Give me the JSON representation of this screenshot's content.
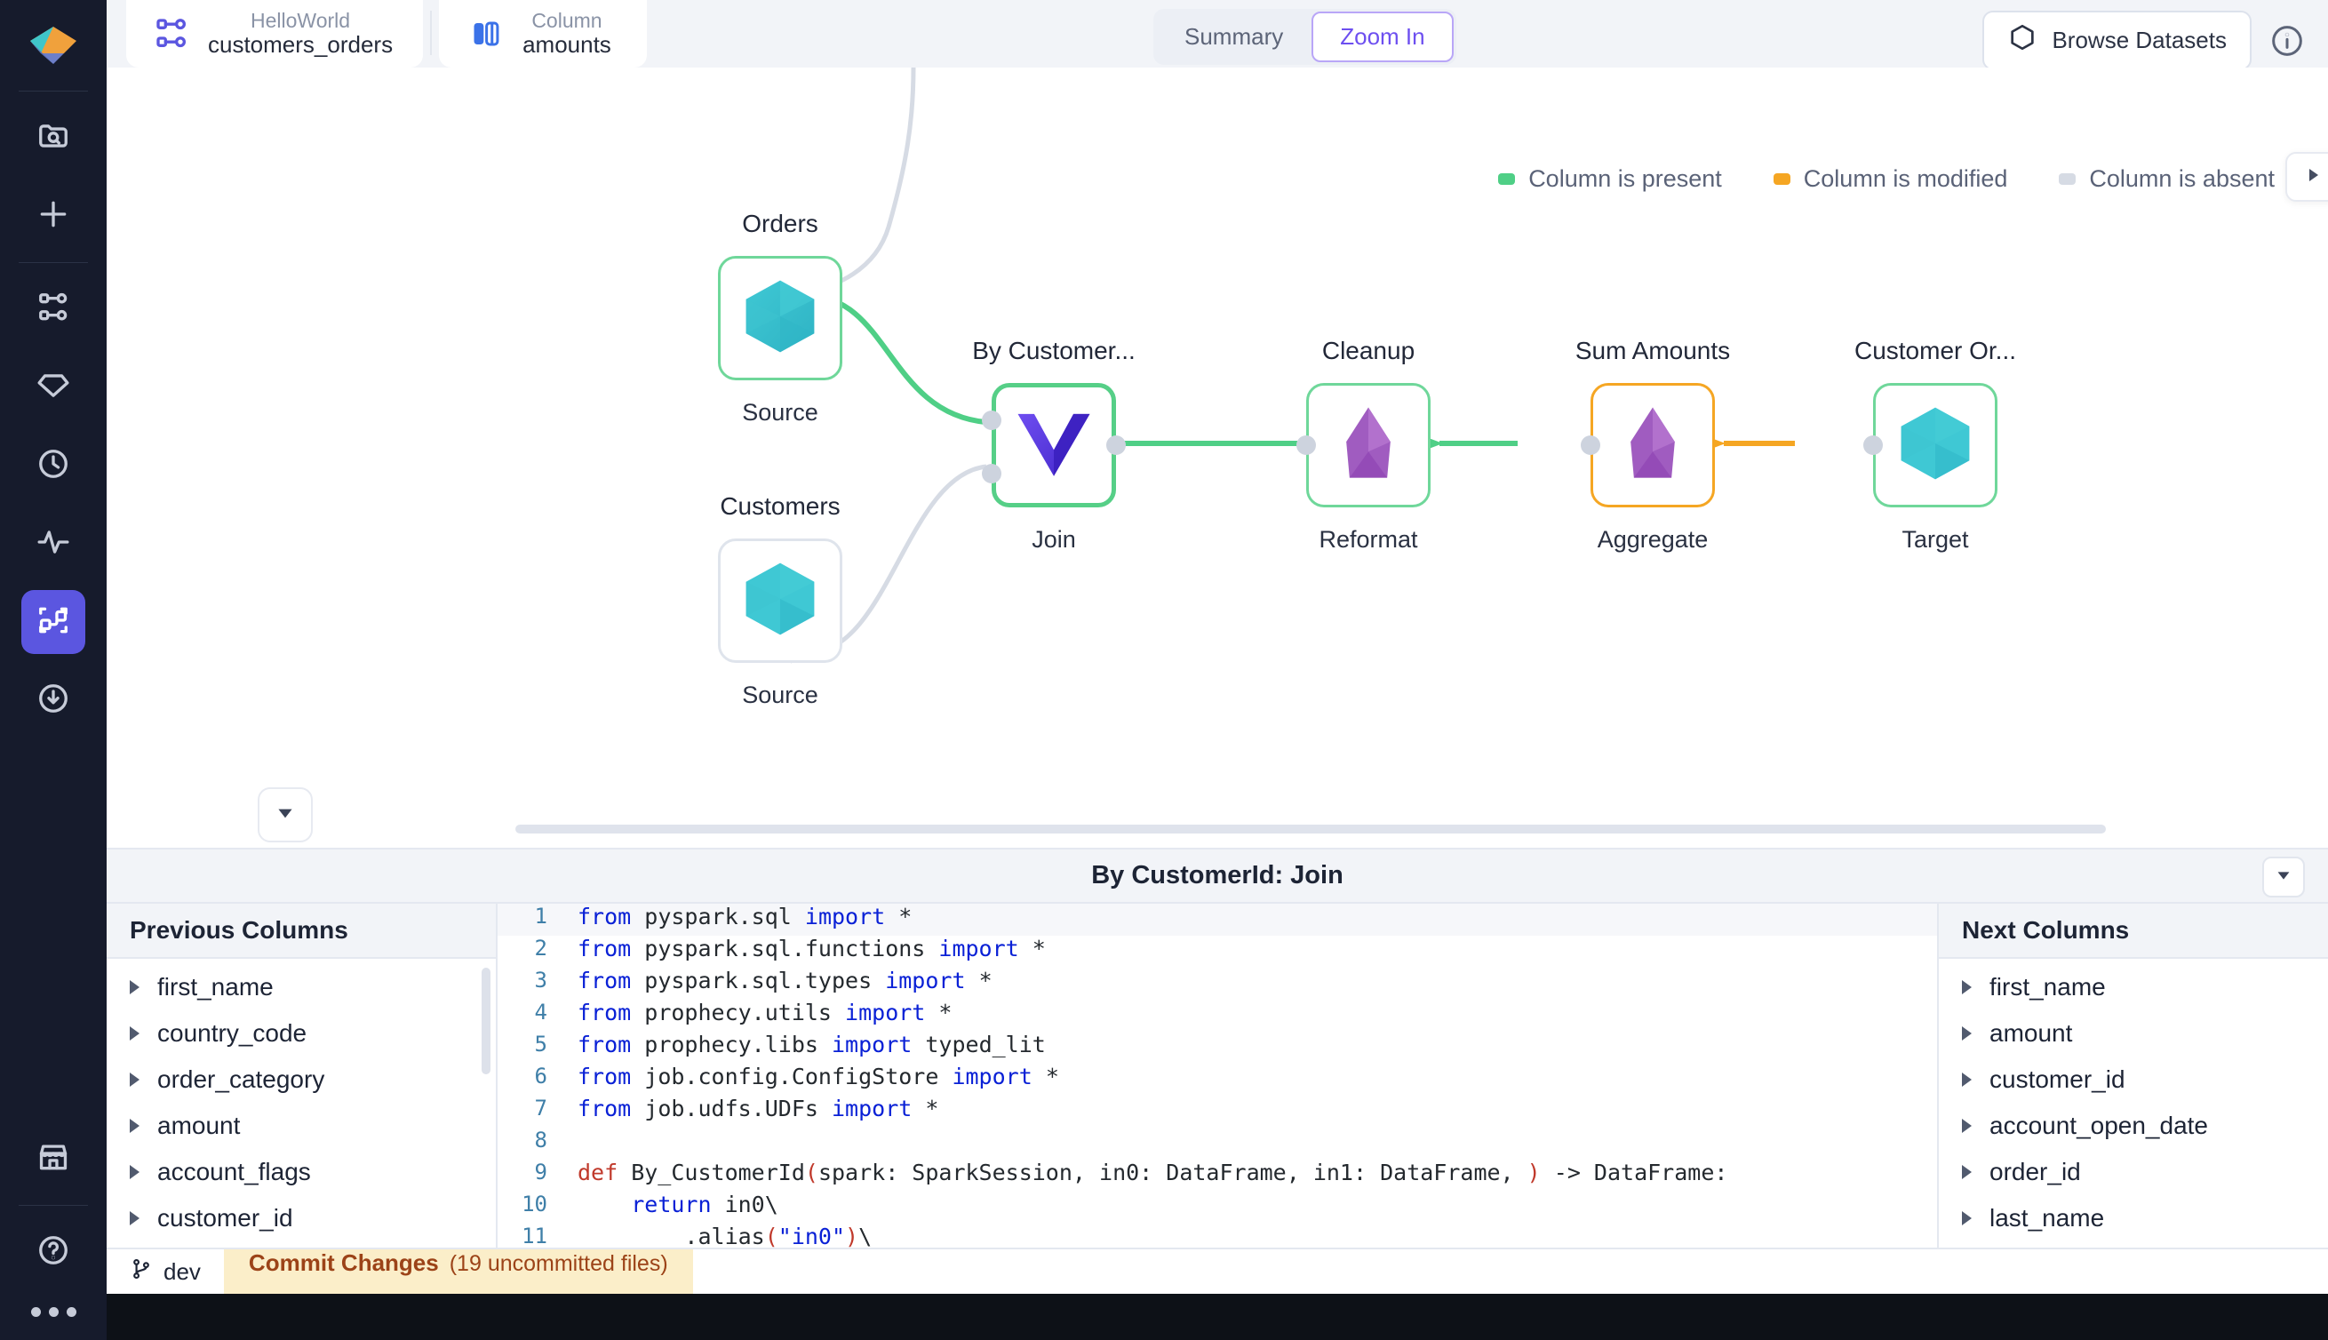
{
  "topbar": {
    "project_tab": {
      "icon": "pipeline-icon",
      "sub": "HelloWorld",
      "main": "customers_orders"
    },
    "column_tab": {
      "icon": "columns-icon",
      "sub": "Column",
      "main": "amounts"
    },
    "segments": [
      {
        "label": "Summary",
        "active": false
      },
      {
        "label": "Zoom In",
        "active": true
      }
    ],
    "browse_datasets": "Browse Datasets",
    "info_icon": "info-icon"
  },
  "legend": [
    {
      "label": "Column is present",
      "color": "#4fcf86"
    },
    {
      "label": "Column is modified",
      "color": "#f5a623"
    },
    {
      "label": "Column is absent",
      "color": "#d6dbe4"
    }
  ],
  "graph": {
    "nodes": [
      {
        "title": "Orders",
        "sub": "Source",
        "shape": "hexagon",
        "border": "green"
      },
      {
        "title": "Customers",
        "sub": "Source",
        "shape": "hexagon",
        "border": "grey"
      },
      {
        "title": "By Customer...",
        "sub": "Join",
        "shape": "chevron",
        "border": "green-thick"
      },
      {
        "title": "Cleanup",
        "sub": "Reformat",
        "shape": "diamond",
        "border": "green"
      },
      {
        "title": "Sum Amounts",
        "sub": "Aggregate",
        "shape": "diamond",
        "border": "orange"
      },
      {
        "title": "Customer Or...",
        "sub": "Target",
        "shape": "hexagon",
        "border": "green"
      }
    ]
  },
  "bottom": {
    "title": "By CustomerId: Join",
    "collapse_icon": "chevron-down-icon",
    "previous_columns": {
      "heading": "Previous Columns",
      "items": [
        "first_name",
        "country_code",
        "order_category",
        "amount",
        "account_flags",
        "customer_id"
      ]
    },
    "next_columns": {
      "heading": "Next Columns",
      "items": [
        "first_name",
        "amount",
        "customer_id",
        "account_open_date",
        "order_id",
        "last_name"
      ]
    },
    "code_lines": [
      {
        "n": "1",
        "text": "from pyspark.sql import *"
      },
      {
        "n": "2",
        "text": "from pyspark.sql.functions import *"
      },
      {
        "n": "3",
        "text": "from pyspark.sql.types import *"
      },
      {
        "n": "4",
        "text": "from prophecy.utils import *"
      },
      {
        "n": "5",
        "text": "from prophecy.libs import typed_lit"
      },
      {
        "n": "6",
        "text": "from job.config.ConfigStore import *"
      },
      {
        "n": "7",
        "text": "from job.udfs.UDFs import *"
      },
      {
        "n": "8",
        "text": ""
      },
      {
        "n": "9",
        "text": "def By_CustomerId(spark: SparkSession, in0: DataFrame, in1: DataFrame, ) -> DataFrame:"
      },
      {
        "n": "10",
        "text": "    return in0\\"
      },
      {
        "n": "11",
        "text": "        .alias(\"in0\")\\"
      }
    ]
  },
  "status": {
    "branch_icon": "branch-icon",
    "branch": "dev",
    "commit_label": "Commit Changes",
    "commit_count": "(19 uncommitted files)"
  },
  "rail": {
    "logo": "prophecy-logo",
    "items": [
      {
        "icon": "folder-search-icon",
        "active": false
      },
      {
        "icon": "plus-icon",
        "active": false
      },
      {
        "icon": "pipeline-icon",
        "active": false
      },
      {
        "icon": "gem-icon",
        "active": false
      },
      {
        "icon": "clock-icon",
        "active": false
      },
      {
        "icon": "activity-icon",
        "active": false
      },
      {
        "icon": "lineage-icon",
        "active": true
      },
      {
        "icon": "download-circle-icon",
        "active": false
      }
    ],
    "bottom_items": [
      {
        "icon": "marketplace-icon"
      },
      {
        "icon": "help-circle-icon"
      }
    ],
    "more_icon": "more-dots-icon"
  }
}
